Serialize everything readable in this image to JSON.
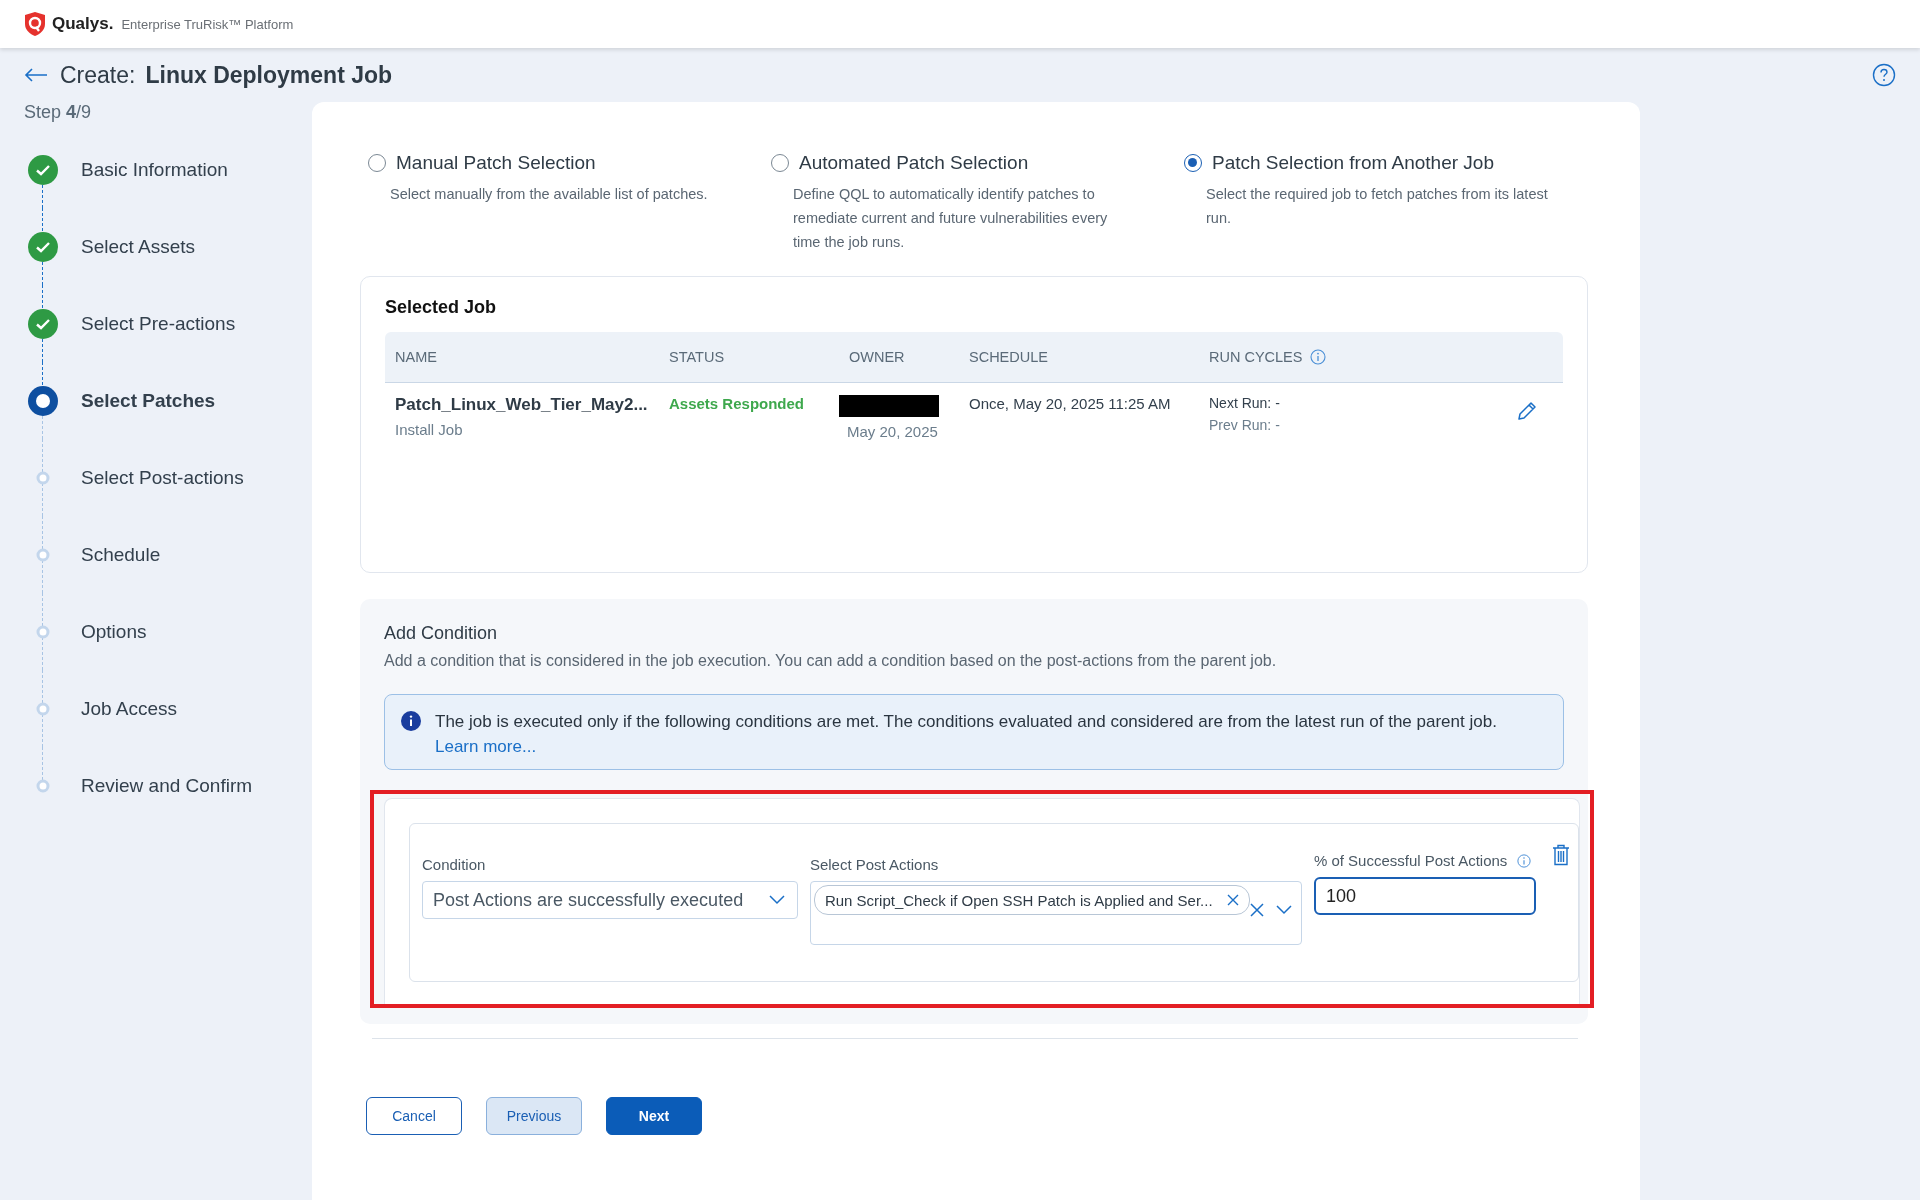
{
  "header": {
    "brand": "Qualys.",
    "product": "Enterprise TruRisk™ Platform"
  },
  "page": {
    "title_prefix": "Create:",
    "title": "Linux Deployment Job",
    "step": "Step **4**/9"
  },
  "steps": [
    {
      "label": "Basic Information",
      "completed": true,
      "selected": false
    },
    {
      "label": "Select Assets",
      "completed": true,
      "selected": false
    },
    {
      "label": "Select Pre-actions",
      "completed": true,
      "selected": false
    },
    {
      "label": "Select Patches",
      "completed": false,
      "selected": true
    },
    {
      "label": "Select Post-actions",
      "completed": false,
      "selected": false
    },
    {
      "label": "Schedule",
      "completed": false,
      "selected": false
    },
    {
      "label": "Options",
      "completed": false,
      "selected": false
    },
    {
      "label": "Job Access",
      "completed": false,
      "selected": false
    },
    {
      "label": "Review and Confirm",
      "completed": false,
      "selected": false
    }
  ],
  "patch_selection": [
    {
      "label": "Manual Patch Selection",
      "description": "Select manually from the available list of patches.",
      "selected": false
    },
    {
      "label": "Automated Patch Selection",
      "description": "Define QQL to automatically identify patches to remediate current and future vulnerabilities every time the job runs.",
      "selected": false
    },
    {
      "label": "Patch Selection from Another Job",
      "description": "Select the required job to fetch patches from its latest run.",
      "selected": true
    }
  ],
  "selected_job": {
    "title": "Selected Job",
    "columns": [
      "NAME",
      "STATUS",
      "OWNER",
      "SCHEDULE",
      "RUN CYCLES"
    ],
    "rows": [
      {
        "name": "Patch_Linux_Web_Tier_May2...",
        "type": "Install Job",
        "status": "Assets Responded",
        "owner_date": "May 20, 2025",
        "schedule": "Once, May 20, 2025 11:25 AM",
        "next_run": "Next Run: -",
        "prev_run": "Prev Run: -"
      }
    ]
  },
  "add_condition": {
    "title": "Add Condition",
    "description": "Add a condition that is considered in the job execution. You can add a condition based on the post-actions from the parent job.",
    "info": {
      "text": "The job is executed only if the following conditions are met. The conditions evaluated and considered are from the latest run of the parent job.",
      "link": "Learn more..."
    },
    "condition": {
      "label": "Condition",
      "value": "Post Actions are successfully executed"
    },
    "post_actions": {
      "label": "Select Post Actions",
      "chips": [
        "Run Script_Check if Open SSH Patch is Applied and Ser..."
      ]
    },
    "percent": {
      "label": "% of Successful Post Actions",
      "value": "100"
    }
  },
  "buttons": [
    {
      "label": "Cancel",
      "kind": "outline"
    },
    {
      "label": "Previous",
      "kind": "secondary"
    },
    {
      "label": "Next",
      "kind": "primary"
    }
  ]
}
